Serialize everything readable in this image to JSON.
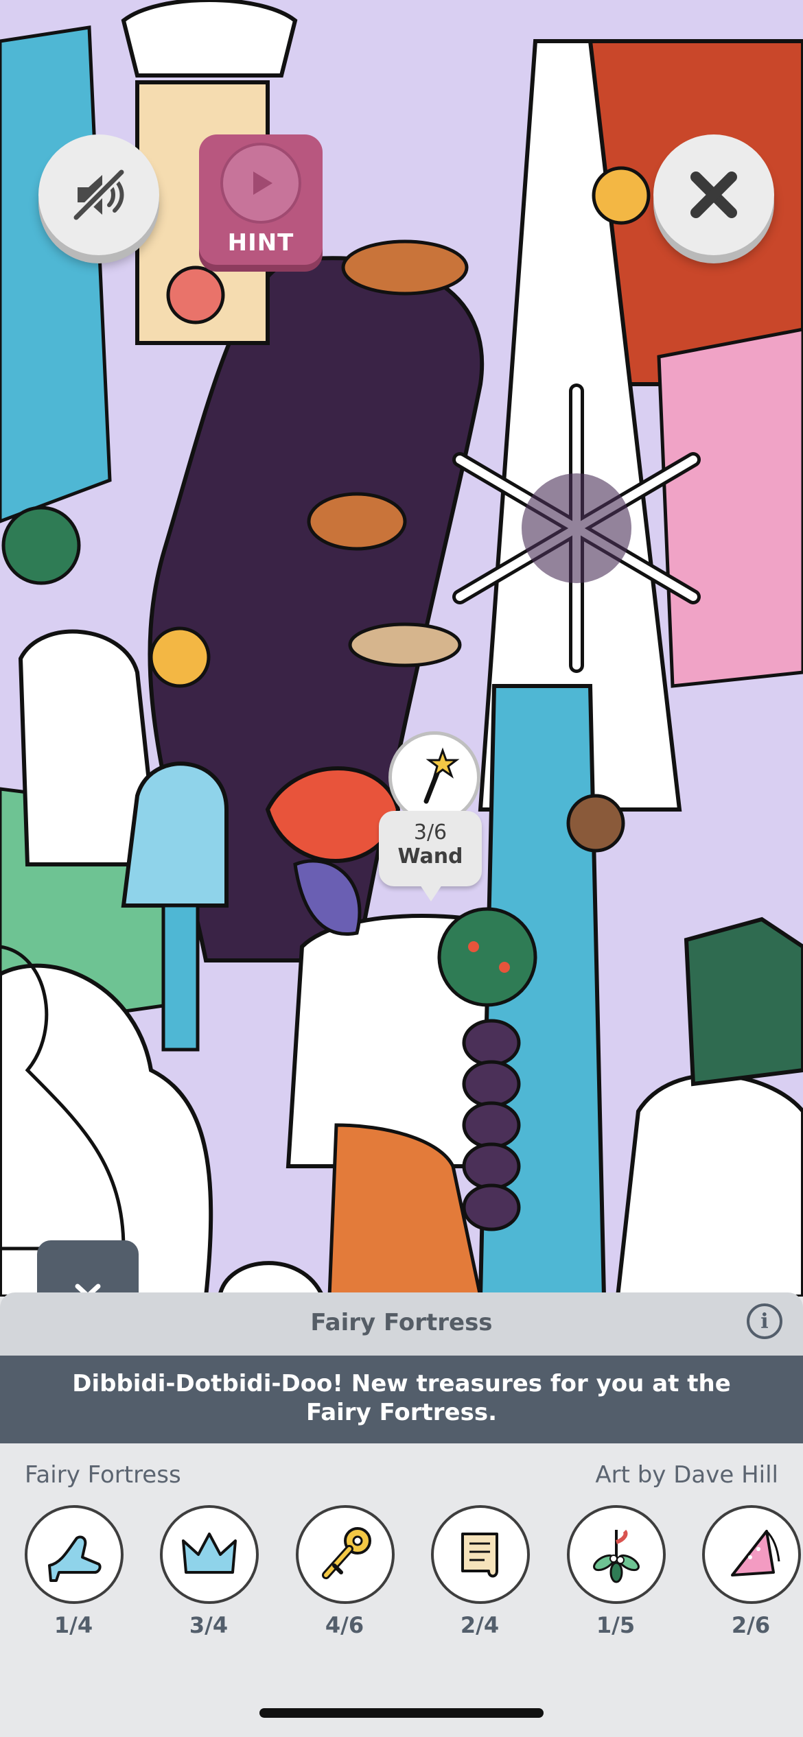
{
  "controls": {
    "hint_label": "HINT"
  },
  "found_marker": {
    "count": "3/6",
    "name": "Wand",
    "icon": "wand-icon"
  },
  "panel": {
    "title": "Fairy Fortress",
    "banner": "Dibbidi-Dotbidi-Doo! New treasures for you at the Fairy Fortress.",
    "scene_label": "Fairy Fortress",
    "artist_label": "Art by Dave Hill"
  },
  "items": [
    {
      "icon": "glass-slipper-icon",
      "count": "1/4"
    },
    {
      "icon": "crown-icon",
      "count": "3/4"
    },
    {
      "icon": "key-icon",
      "count": "4/6"
    },
    {
      "icon": "scroll-icon",
      "count": "2/4"
    },
    {
      "icon": "mistletoe-icon",
      "count": "1/5"
    },
    {
      "icon": "fairy-hat-icon",
      "count": "2/6"
    }
  ],
  "colors": {
    "hint": "#b8577f",
    "panel_dark": "#535e6b",
    "panel_light": "#d3d6da"
  }
}
